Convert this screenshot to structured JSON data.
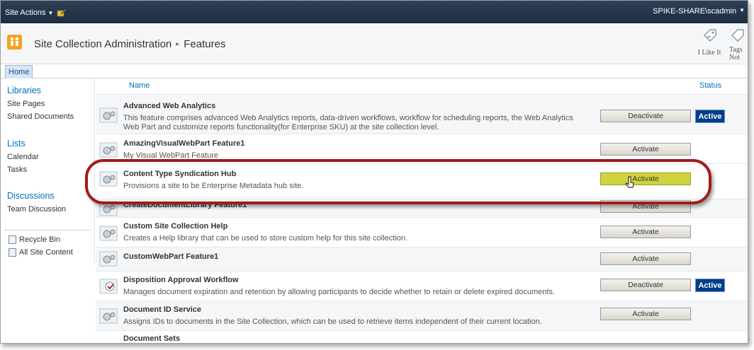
{
  "topbar": {
    "site_actions_label": "Site Actions",
    "user_label": "SPIKE-SHARE\\scadmin"
  },
  "title": {
    "breadcrumb_root": "Site Collection Administration",
    "separator": "▸",
    "current": "Features",
    "logo_icon": "sharepoint-site-icon"
  },
  "ribbon": {
    "like_label": "I Like It",
    "tags_label_1": "Tags",
    "tags_label_2": "Not"
  },
  "tabs": {
    "home": "Home"
  },
  "leftnav": {
    "libraries": "Libraries",
    "site_pages": "Site Pages",
    "shared_documents": "Shared Documents",
    "lists": "Lists",
    "calendar": "Calendar",
    "tasks": "Tasks",
    "discussions": "Discussions",
    "team_discussion": "Team Discussion",
    "recycle_bin": "Recycle Bin",
    "all_site_content": "All Site Content"
  },
  "columns": {
    "name": "Name",
    "status": "Status"
  },
  "features": [
    {
      "title": "Advanced Web Analytics",
      "desc": "This feature comprises advanced Web Analytics reports, data-driven workflows, workflow for scheduling reports, the Web Analytics Web Part and customize reports functionality(for Enterprise SKU) at the site collection level.",
      "button": "Deactivate",
      "status": "Active"
    },
    {
      "title": "AmazingVisualWebPart Feature1",
      "desc": "My Visual WebPart Feature",
      "button": "Activate",
      "status": ""
    },
    {
      "title": "Content Type Syndication Hub",
      "desc": "Provisions a site to be Enterprise Metadata hub site.",
      "button": "Activate",
      "status": ""
    },
    {
      "title": "CreateDocumentLibrary Feature1",
      "desc": "",
      "button": "Activate",
      "status": ""
    },
    {
      "title": "Custom Site Collection Help",
      "desc": "Creates a Help library that can be used to store custom help for this site collection.",
      "button": "Activate",
      "status": ""
    },
    {
      "title": "CustomWebPart Feature1",
      "desc": "",
      "button": "Activate",
      "status": ""
    },
    {
      "title": "Disposition Approval Workflow",
      "desc": "Manages document expiration and retention by allowing participants to decide whether to retain or delete expired documents.",
      "button": "Deactivate",
      "status": "Active"
    },
    {
      "title": "Document ID Service",
      "desc": "Assigns IDs to documents in the Site Collection, which can be used to retrieve items independent of their current location.",
      "button": "Activate",
      "status": ""
    },
    {
      "title": "Document Sets",
      "desc": "",
      "button": "",
      "status": ""
    }
  ],
  "colors": {
    "topbar": "#1d2d42",
    "link_blue": "#0072bc",
    "active_badge": "#003e8c",
    "highlight_button": "#cfd33d",
    "callout_ring": "#a11b1b"
  }
}
